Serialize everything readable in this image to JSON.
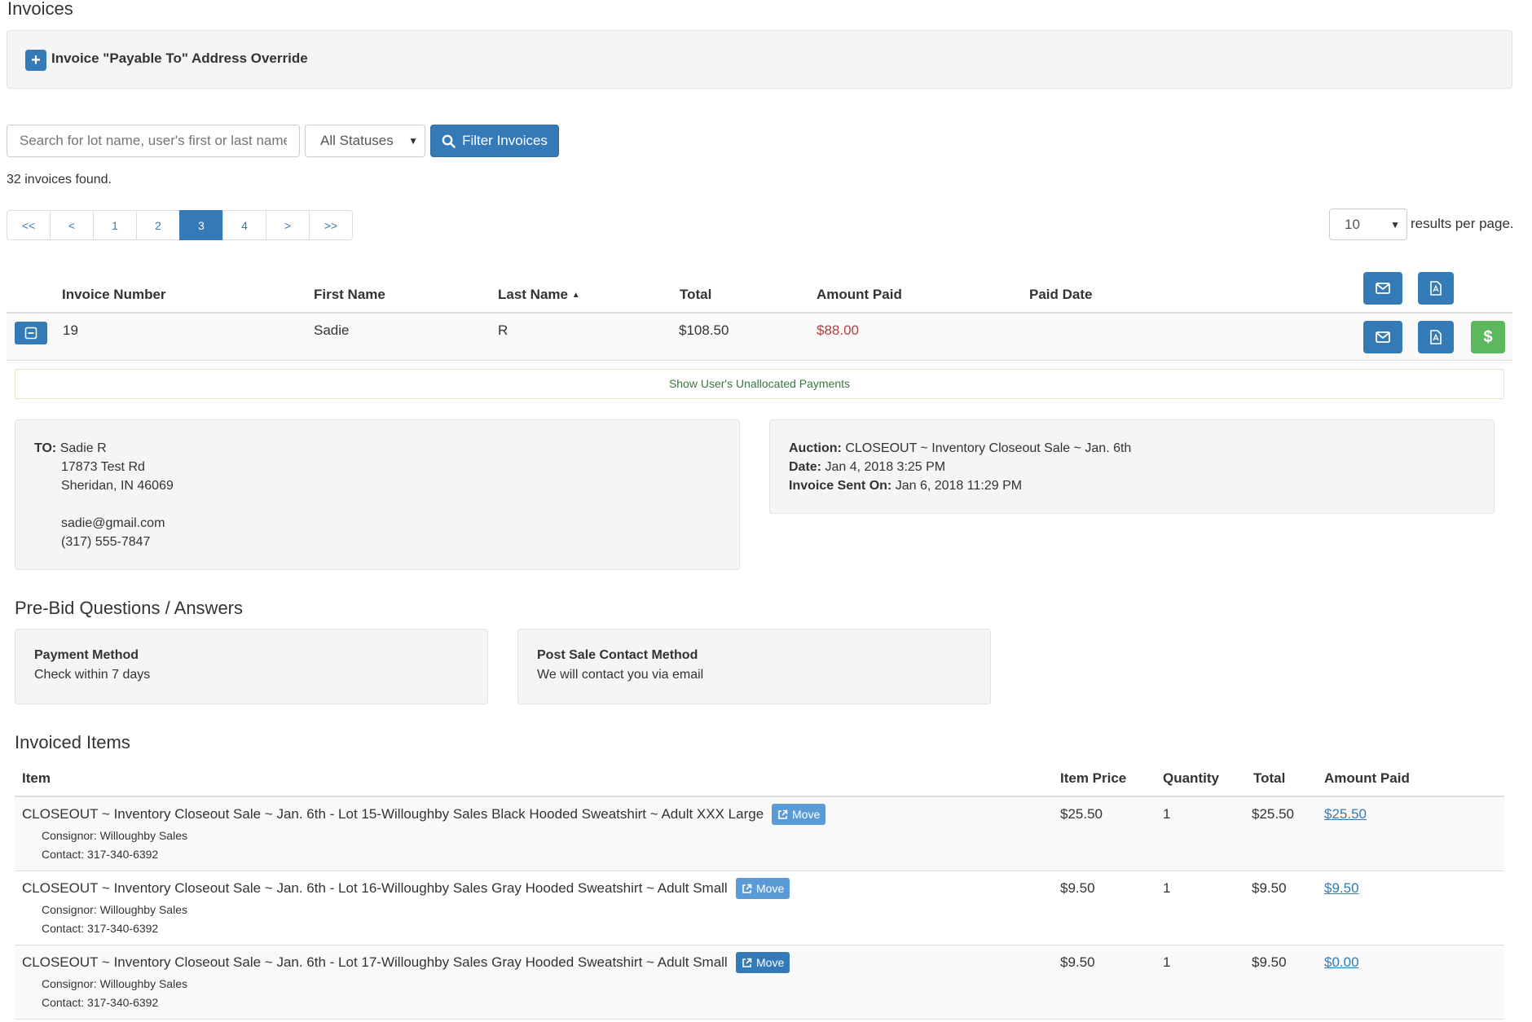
{
  "page": {
    "title": "Invoices"
  },
  "override": {
    "label": "Invoice \"Payable To\" Address Override"
  },
  "filter": {
    "search_placeholder": "Search for lot name, user's first or last name",
    "status_selected": "All Statuses",
    "filter_button": "Filter Invoices",
    "found_text": "32 invoices found."
  },
  "pagination": {
    "pages": [
      "<<",
      "<",
      "1",
      "2",
      "3",
      "4",
      ">",
      ">>"
    ],
    "active": "3",
    "per_page": "10",
    "per_page_label": "results per page."
  },
  "table": {
    "headers": {
      "invoice_number": "Invoice Number",
      "first_name": "First Name",
      "last_name": "Last Name",
      "total": "Total",
      "amount_paid": "Amount Paid",
      "paid_date": "Paid Date"
    },
    "row": {
      "invoice_number": "19",
      "first_name": "Sadie",
      "last_name": "R",
      "total": "$108.50",
      "amount_paid": "$88.00",
      "paid_date": ""
    },
    "unallocated_label": "Show User's Unallocated Payments"
  },
  "to_panel": {
    "label": "TO:",
    "name": "Sadie R",
    "street": "17873 Test Rd",
    "city": "Sheridan, IN 46069",
    "email": "sadie@gmail.com",
    "phone": "(317) 555-7847"
  },
  "auction_panel": {
    "auction_label": "Auction:",
    "auction_value": "CLOSEOUT ~ Inventory Closeout Sale ~ Jan. 6th",
    "date_label": "Date:",
    "date_value": "Jan 4, 2018 3:25 PM",
    "sent_label": "Invoice Sent On:",
    "sent_value": "Jan 6, 2018 11:29 PM"
  },
  "prebid": {
    "title": "Pre-Bid Questions / Answers",
    "questions": [
      {
        "question": "Payment Method",
        "answer": "Check within 7 days"
      },
      {
        "question": "Post Sale Contact Method",
        "answer": "We will contact you via email"
      }
    ]
  },
  "items": {
    "title": "Invoiced Items",
    "headers": {
      "item": "Item",
      "price": "Item Price",
      "quantity": "Quantity",
      "total": "Total",
      "paid": "Amount Paid"
    },
    "move_label": "Move",
    "rows": [
      {
        "name": "CLOSEOUT ~ Inventory Closeout Sale ~ Jan. 6th - Lot 15-Willoughby Sales Black Hooded Sweatshirt ~ Adult XXX Large",
        "consignor": "Consignor: Willoughby Sales",
        "contact": "Contact: 317-340-6392",
        "price": "$25.50",
        "quantity": "1",
        "total": "$25.50",
        "paid": "$25.50"
      },
      {
        "name": "CLOSEOUT ~ Inventory Closeout Sale ~ Jan. 6th - Lot 16-Willoughby Sales Gray Hooded Sweatshirt ~ Adult Small",
        "consignor": "Consignor: Willoughby Sales",
        "contact": "Contact: 317-340-6392",
        "price": "$9.50",
        "quantity": "1",
        "total": "$9.50",
        "paid": "$9.50"
      },
      {
        "name": "CLOSEOUT ~ Inventory Closeout Sale ~ Jan. 6th - Lot 17-Willoughby Sales Gray Hooded Sweatshirt ~ Adult Small",
        "consignor": "Consignor: Willoughby Sales",
        "contact": "Contact: 317-340-6392",
        "price": "$9.50",
        "quantity": "1",
        "total": "$9.50",
        "paid": "$0.00"
      }
    ]
  },
  "colors": {
    "primary": "#337ab7",
    "success": "#5cb85c",
    "danger_text": "#a94442",
    "success_text": "#3c763d"
  }
}
